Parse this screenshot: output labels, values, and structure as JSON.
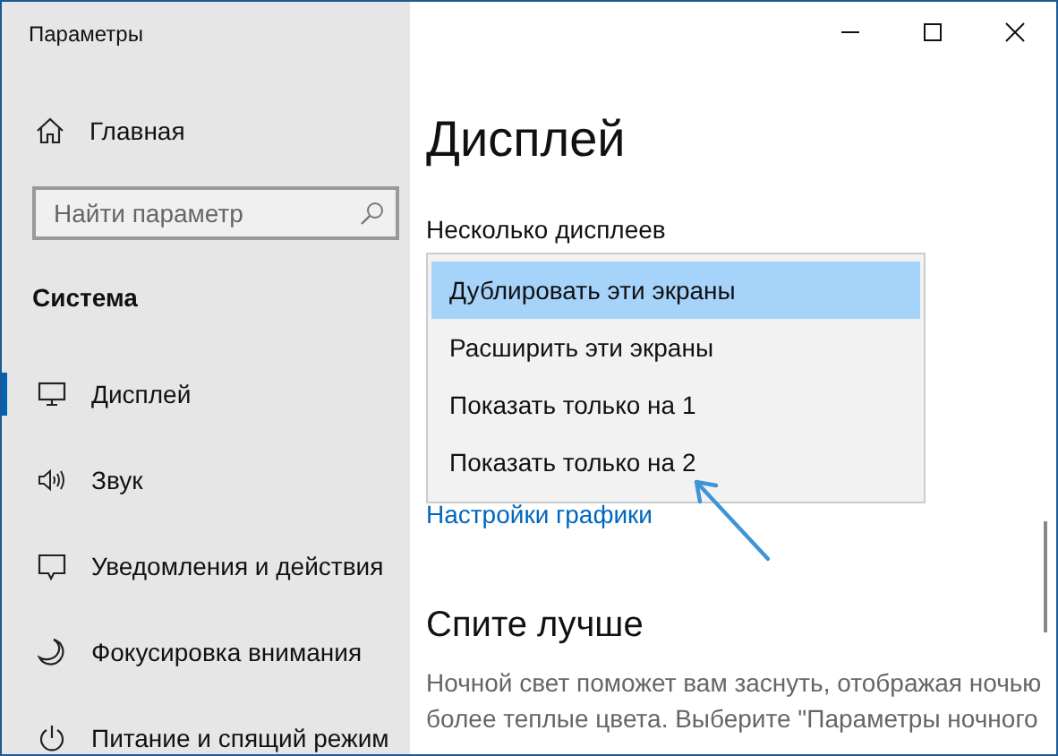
{
  "window": {
    "title": "Параметры"
  },
  "sidebar": {
    "home": "Главная",
    "search": {
      "placeholder": "Найти параметр"
    },
    "section": "Система",
    "items": [
      {
        "label": "Дисплей",
        "selected": true
      },
      {
        "label": "Звук",
        "selected": false
      },
      {
        "label": "Уведомления и действия",
        "selected": false
      },
      {
        "label": "Фокусировка внимания",
        "selected": false
      },
      {
        "label": "Питание и спящий режим",
        "selected": false
      }
    ]
  },
  "content": {
    "heading": "Дисплей",
    "dropdown_label": "Несколько дисплеев",
    "dropdown_options": [
      {
        "label": "Дублировать эти экраны",
        "selected": true
      },
      {
        "label": "Расширить эти экраны",
        "selected": false
      },
      {
        "label": "Показать только на 1",
        "selected": false
      },
      {
        "label": "Показать только на 2",
        "selected": false
      }
    ],
    "link": "Настройки графики",
    "section_heading": "Спите лучше",
    "paragraph_lines": [
      "Ночной свет поможет вам заснуть, отображая ночью",
      "более теплые цвета. Выберите \"Параметры ночного"
    ]
  }
}
